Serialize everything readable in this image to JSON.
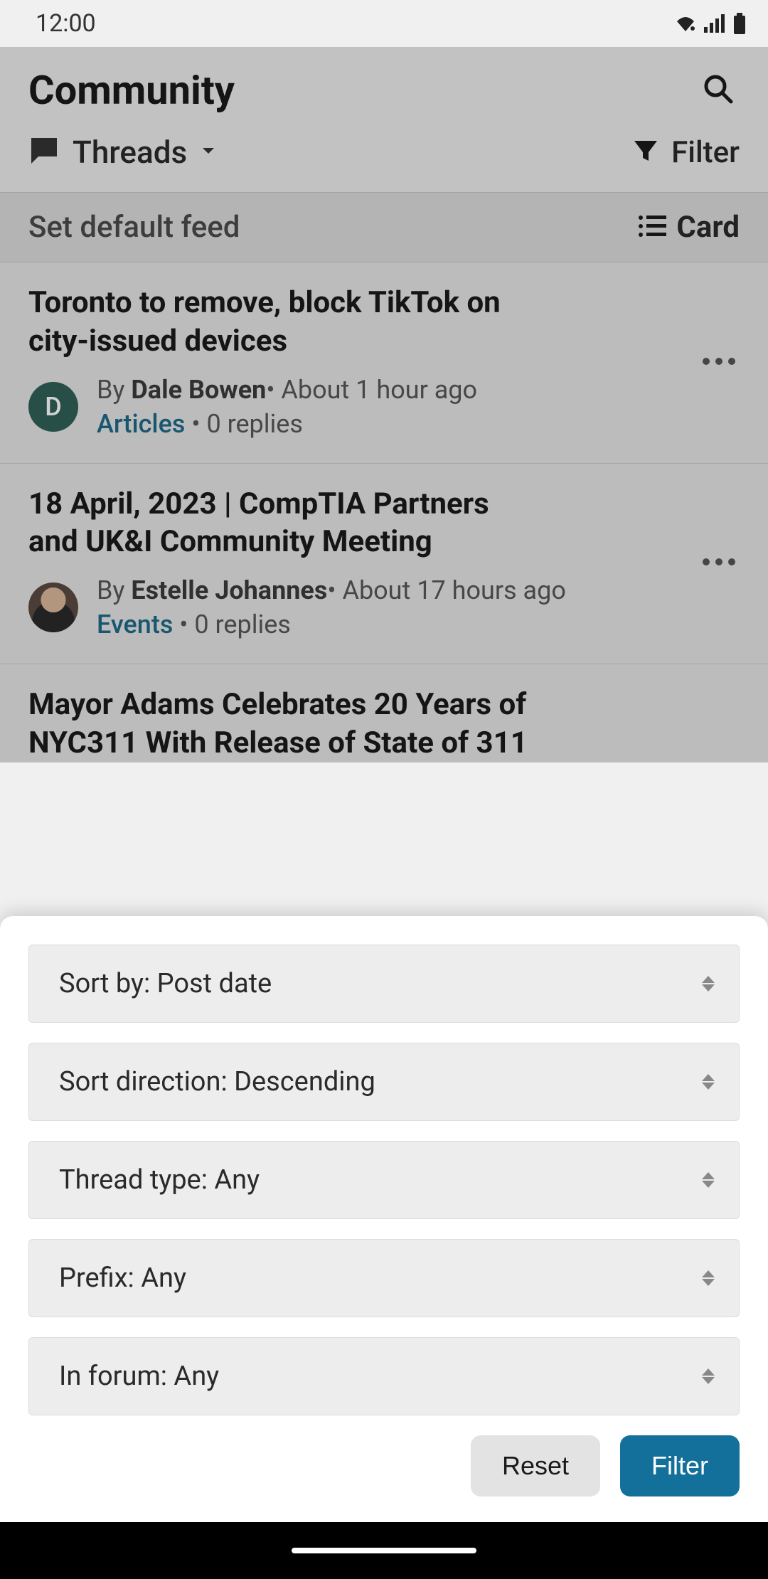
{
  "status": {
    "time": "12:00"
  },
  "header": {
    "title": "Community"
  },
  "tabs": {
    "threads_label": "Threads",
    "filter_label": "Filter"
  },
  "default_feed": {
    "label": "Set default feed",
    "view_label": "Card"
  },
  "threads": [
    {
      "title": "Toronto to remove, block TikTok on city-issued devices",
      "by_prefix": "By ",
      "author": "Dale Bowen",
      "time_sep": "• ",
      "time": "About 1 hour ago",
      "category": "Articles",
      "replies_sep": " • ",
      "replies": "0 replies",
      "avatar_letter": "D"
    },
    {
      "title": "18 April, 2023 | CompTIA Partners and UK&I Community Meeting",
      "by_prefix": "By ",
      "author": "Estelle Johannes",
      "time_sep": "• ",
      "time": "About 17 hours ago",
      "category": "Events",
      "replies_sep": " • ",
      "replies": "0 replies",
      "avatar_letter": ""
    },
    {
      "title": "Mayor Adams Celebrates 20 Years of NYC311 With Release of State of 311"
    }
  ],
  "filter_sheet": {
    "options": [
      {
        "label": "Sort by: Post date"
      },
      {
        "label": "Sort direction: Descending"
      },
      {
        "label": "Thread type: Any"
      },
      {
        "label": "Prefix: Any"
      },
      {
        "label": "In forum: Any"
      }
    ],
    "reset_label": "Reset",
    "filter_label": "Filter"
  }
}
